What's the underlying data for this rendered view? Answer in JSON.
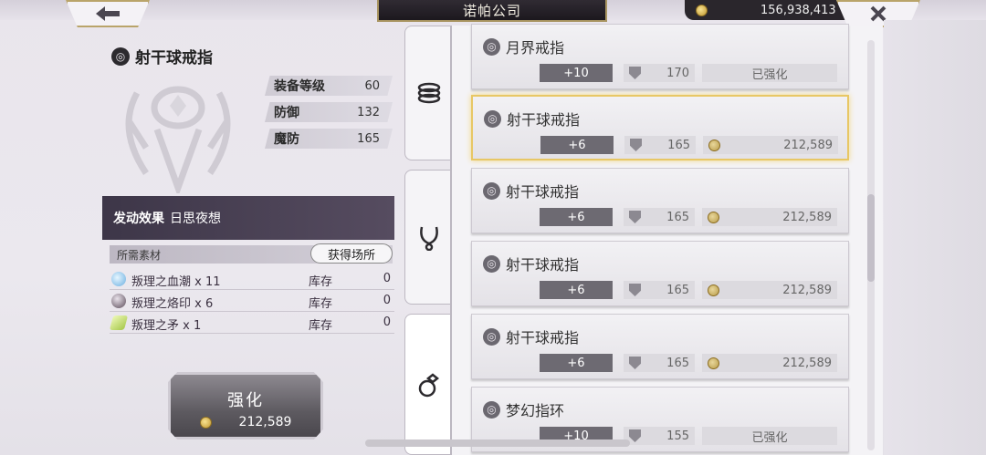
{
  "header": {
    "title": "诺帕公司",
    "currency": "156,938,413"
  },
  "item": {
    "name": "射干球戒指",
    "stats": [
      {
        "label": "装备等级",
        "value": "60"
      },
      {
        "label": "防御",
        "value": "132"
      },
      {
        "label": "魔防",
        "value": "165"
      }
    ],
    "effect_label": "发动效果",
    "effect_value": "日思夜想"
  },
  "materials": {
    "header": "所需素材",
    "obtain_label": "获得场所",
    "stock_label": "库存",
    "items": [
      {
        "name": "叛理之血潮 x 11",
        "stock": "0",
        "color": "#8fc6ea"
      },
      {
        "name": "叛理之烙印 x 6",
        "stock": "0",
        "color": "#7a6a78"
      },
      {
        "name": "叛理之矛 x 1",
        "stock": "0",
        "color": "#c9e27a"
      }
    ]
  },
  "enhance": {
    "label": "强化",
    "cost": "212,589"
  },
  "list": {
    "items": [
      {
        "name": "月界戒指",
        "level": "+10",
        "defense": "170",
        "status": "已强化",
        "selected": false
      },
      {
        "name": "射干球戒指",
        "level": "+6",
        "defense": "165",
        "price": "212,589",
        "selected": true
      },
      {
        "name": "射干球戒指",
        "level": "+6",
        "defense": "165",
        "price": "212,589",
        "selected": false
      },
      {
        "name": "射干球戒指",
        "level": "+6",
        "defense": "165",
        "price": "212,589",
        "selected": false
      },
      {
        "name": "射干球戒指",
        "level": "+6",
        "defense": "165",
        "price": "212,589",
        "selected": false
      },
      {
        "name": "梦幻指环",
        "level": "+10",
        "defense": "155",
        "status": "已强化",
        "selected": false
      }
    ]
  },
  "icons": {
    "back": "back-arrow-icon",
    "close": "close-icon",
    "coin": "coin-icon",
    "tab_bracelet": "bracelet-icon",
    "tab_necklace": "necklace-icon",
    "tab_ring": "ring-icon"
  }
}
